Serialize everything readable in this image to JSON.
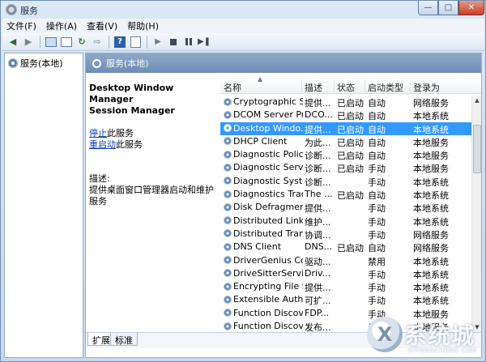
{
  "window": {
    "title": "服务"
  },
  "menu": [
    "文件(F)",
    "操作(A)",
    "查看(V)",
    "帮助(H)"
  ],
  "tree": {
    "root": "服务(本地)"
  },
  "main": {
    "header": "服务(本地)"
  },
  "detail": {
    "service_name_line1": "Desktop Window Manager",
    "service_name_line2": "Session Manager",
    "stop_link": "停止",
    "stop_suffix": "此服务",
    "restart_link": "重启动",
    "restart_suffix": "此服务",
    "desc_label": "描述:",
    "desc_text": "提供桌面窗口管理器启动和维护服务"
  },
  "columns": [
    "名称",
    "描述",
    "状态",
    "启动类型",
    "登录为"
  ],
  "rows": [
    {
      "name": "Cryptographic S...",
      "desc": "提供...",
      "status": "已启动",
      "start": "自动",
      "logon": "网络服务"
    },
    {
      "name": "DCOM Server Pr...",
      "desc": "DCO...",
      "status": "已启动",
      "start": "自动",
      "logon": "本地系统"
    },
    {
      "name": "Desktop Windo...",
      "desc": "提供...",
      "status": "已启动",
      "start": "自动",
      "logon": "本地系统"
    },
    {
      "name": "DHCP Client",
      "desc": "为此...",
      "status": "已启动",
      "start": "自动",
      "logon": "本地服务"
    },
    {
      "name": "Diagnostic Polic...",
      "desc": "诊断...",
      "status": "已启动",
      "start": "自动",
      "logon": "本地服务"
    },
    {
      "name": "Diagnostic Servi...",
      "desc": "诊断...",
      "status": "已启动",
      "start": "手动",
      "logon": "本地服务"
    },
    {
      "name": "Diagnostic Syste...",
      "desc": "诊断...",
      "status": "",
      "start": "手动",
      "logon": "本地系统"
    },
    {
      "name": "Diagnostics Trac...",
      "desc": "The ...",
      "status": "已启动",
      "start": "自动",
      "logon": "本地系统"
    },
    {
      "name": "Disk Defragmen...",
      "desc": "提供...",
      "status": "",
      "start": "手动",
      "logon": "本地系统"
    },
    {
      "name": "Distributed Link ...",
      "desc": "维护...",
      "status": "",
      "start": "手动",
      "logon": "本地系统"
    },
    {
      "name": "Distributed Tran...",
      "desc": "协调...",
      "status": "",
      "start": "手动",
      "logon": "网络服务"
    },
    {
      "name": "DNS Client",
      "desc": "DNS...",
      "status": "已启动",
      "start": "自动",
      "logon": "网络服务"
    },
    {
      "name": "DriverGenius Co...",
      "desc": "驱动...",
      "status": "",
      "start": "禁用",
      "logon": "本地系统"
    },
    {
      "name": "DriveSitterService",
      "desc": "Driv...",
      "status": "",
      "start": "手动",
      "logon": "本地系统"
    },
    {
      "name": "Encrypting File S...",
      "desc": "提供...",
      "status": "",
      "start": "手动",
      "logon": "本地系统"
    },
    {
      "name": "Extensible Authe...",
      "desc": "可扩...",
      "status": "",
      "start": "手动",
      "logon": "本地系统"
    },
    {
      "name": "Function Discove...",
      "desc": "FDP...",
      "status": "",
      "start": "手动",
      "logon": "本地服务"
    },
    {
      "name": "Function Discove...",
      "desc": "发布...",
      "status": "",
      "start": "手动",
      "logon": "本地服务"
    }
  ],
  "selected_row": 2,
  "tabs": [
    "扩展",
    "标准"
  ],
  "watermark": {
    "main": "系统城",
    "sub": "XITONGCHENG.COM"
  }
}
